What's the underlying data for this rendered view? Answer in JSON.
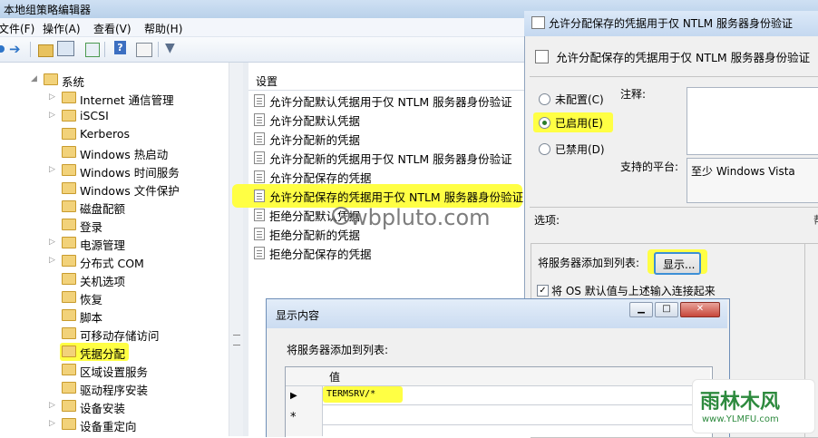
{
  "window": {
    "title": "本地组策略编辑器"
  },
  "menu": [
    "文件(F)",
    "操作(A)",
    "查看(V)",
    "帮助(H)"
  ],
  "tree": [
    {
      "label": "系统",
      "depth": 0,
      "arrow": "expanded"
    },
    {
      "label": "Internet 通信管理",
      "depth": 1,
      "arrow": "collapsed"
    },
    {
      "label": "iSCSI",
      "depth": 1,
      "arrow": "collapsed"
    },
    {
      "label": "Kerberos",
      "depth": 1,
      "arrow": ""
    },
    {
      "label": "Windows 热启动",
      "depth": 1,
      "arrow": ""
    },
    {
      "label": "Windows 时间服务",
      "depth": 1,
      "arrow": "collapsed"
    },
    {
      "label": "Windows 文件保护",
      "depth": 1,
      "arrow": ""
    },
    {
      "label": "磁盘配额",
      "depth": 1,
      "arrow": ""
    },
    {
      "label": "登录",
      "depth": 1,
      "arrow": ""
    },
    {
      "label": "电源管理",
      "depth": 1,
      "arrow": "collapsed"
    },
    {
      "label": "分布式 COM",
      "depth": 1,
      "arrow": "collapsed"
    },
    {
      "label": "关机选项",
      "depth": 1,
      "arrow": ""
    },
    {
      "label": "恢复",
      "depth": 1,
      "arrow": ""
    },
    {
      "label": "脚本",
      "depth": 1,
      "arrow": ""
    },
    {
      "label": "可移动存储访问",
      "depth": 1,
      "arrow": ""
    },
    {
      "label": "凭据分配",
      "depth": 1,
      "arrow": "",
      "highlight": true
    },
    {
      "label": "区域设置服务",
      "depth": 1,
      "arrow": ""
    },
    {
      "label": "驱动程序安装",
      "depth": 1,
      "arrow": ""
    },
    {
      "label": "设备安装",
      "depth": 1,
      "arrow": "collapsed"
    },
    {
      "label": "设备重定向",
      "depth": 1,
      "arrow": "collapsed"
    }
  ],
  "list": {
    "header": "设置",
    "rows": [
      {
        "label": "允许分配默认凭据用于仅 NTLM 服务器身份验证"
      },
      {
        "label": "允许分配默认凭据"
      },
      {
        "label": "允许分配新的凭据"
      },
      {
        "label": "允许分配新的凭据用于仅 NTLM 服务器身份验证"
      },
      {
        "label": "允许分配保存的凭据"
      },
      {
        "label": "允许分配保存的凭据用于仅 NTLM 服务器身份验证",
        "highlight": true
      },
      {
        "label": "拒绝分配默认凭据"
      },
      {
        "label": "拒绝分配新的凭据"
      },
      {
        "label": "拒绝分配保存的凭据"
      }
    ]
  },
  "watermark": "wbpluto.com",
  "policy": {
    "title": "允许分配保存的凭据用于仅 NTLM 服务器身份验证",
    "heading": "允许分配保存的凭据用于仅 NTLM 服务器身份验证",
    "radios": [
      "未配置(C)",
      "已启用(E)",
      "已禁用(D)"
    ],
    "selected": 1,
    "comment_label": "注释:",
    "platform_label": "支持的平台:",
    "platform_value": "至少 Windows Vista",
    "options_label": "选项:",
    "add_server_label": "将服务器添加到列表:",
    "show_button": "显示...",
    "checkbox_label": "将 OS 默认值与上述输入连接起来",
    "checkbox_checked": true
  },
  "show_dialog": {
    "title": "显示内容",
    "list_label": "将服务器添加到列表:",
    "column": "值",
    "rows": [
      "TERMSRV/*",
      ""
    ],
    "new_row_marker": "*",
    "current_row_marker": "▶"
  },
  "logo": {
    "text": "雨林木风",
    "url": "www.YLMFU.com"
  },
  "colors": {
    "highlight": "#ffff44",
    "title_bg": "#c4d8f0"
  }
}
